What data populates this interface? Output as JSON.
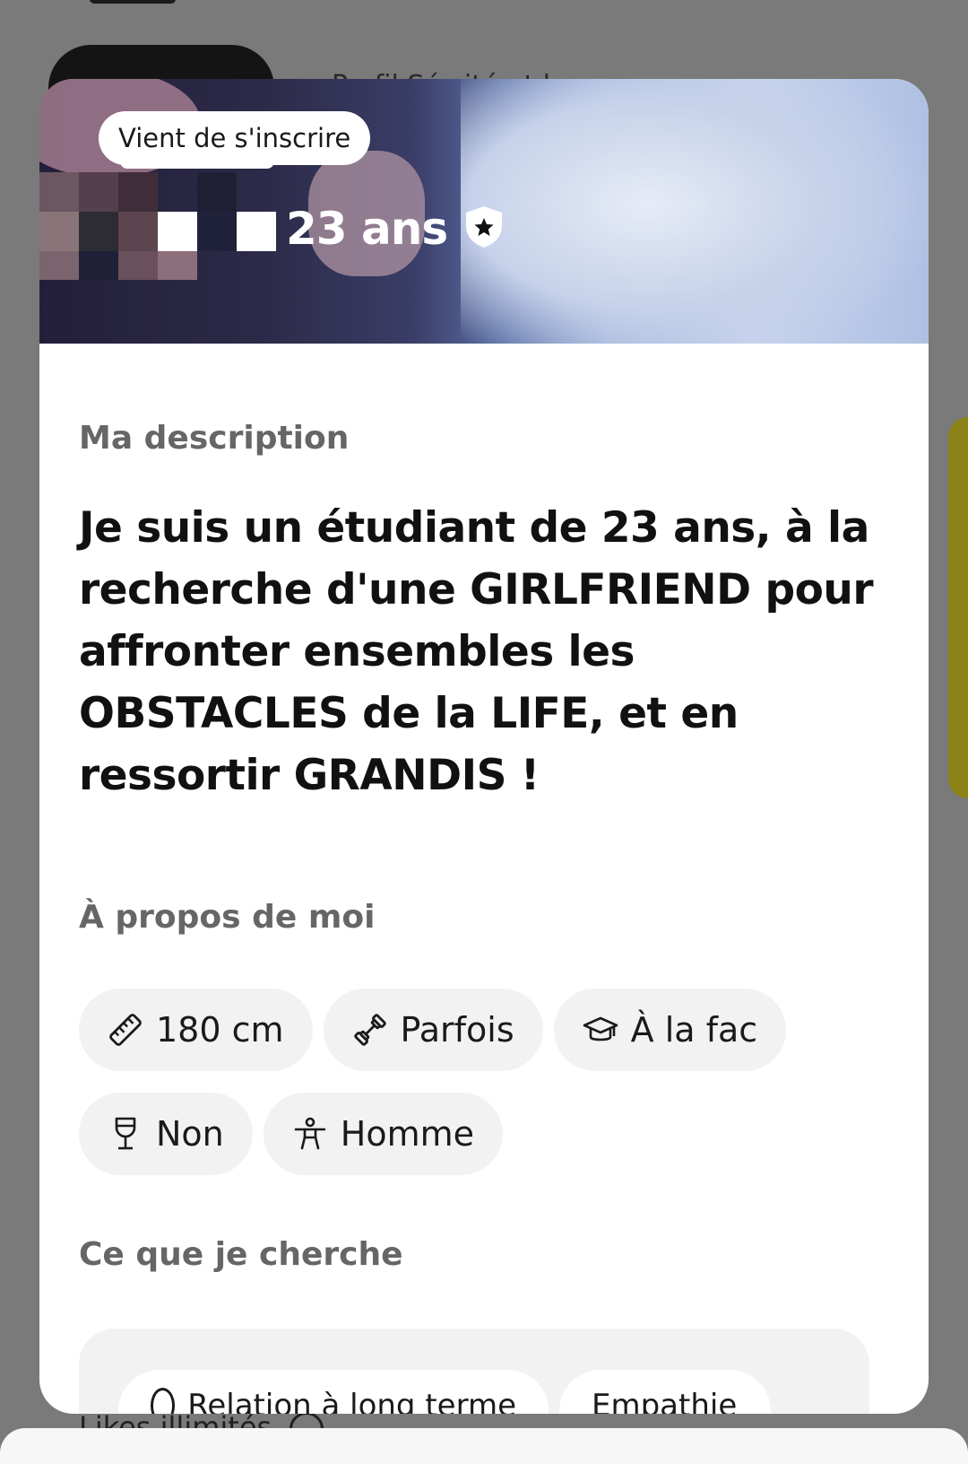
{
  "background": {
    "filters_text": "Profil          Séc   ité et b",
    "likes_label": "Likes illimités"
  },
  "profile": {
    "badge": "Vient de s'inscrire",
    "age": "23 ans",
    "description_title": "Ma description",
    "description": "Je suis un étudiant de 23 ans, à la recherche d'une GIRLFRIEND pour affronter ensembles les OBSTACLES de la LIFE, et en ressortir GRANDIS !",
    "about_title": "À propos de moi",
    "about_chips": [
      {
        "icon": "ruler-icon",
        "label": "180 cm"
      },
      {
        "icon": "dumbbell-icon",
        "label": "Parfois"
      },
      {
        "icon": "graduation-cap-icon",
        "label": "À la fac"
      },
      {
        "icon": "wine-glass-icon",
        "label": "Non"
      },
      {
        "icon": "person-icon",
        "label": "Homme"
      }
    ],
    "looking_title": "Ce que je cherche",
    "looking_chips": [
      "Relation à long terme",
      "Empathie"
    ]
  },
  "colors": {
    "overlay": "#7a7a7a",
    "card": "#ffffff",
    "chip": "#f2f2f2",
    "side_accent": "#8d8218"
  }
}
